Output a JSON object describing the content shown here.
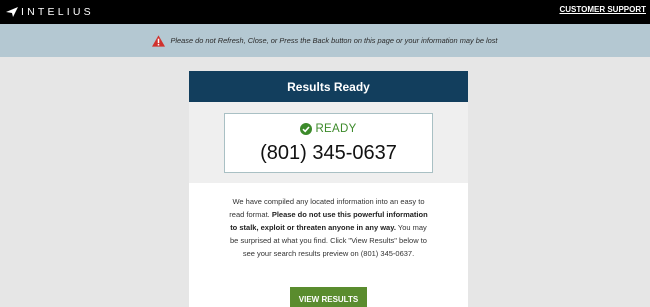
{
  "header": {
    "logo_text": "INTELIUS",
    "support_link": "CUSTOMER SUPPORT"
  },
  "warning": {
    "icon": "warning-triangle-icon",
    "text": "Please do not Refresh, Close, or Press the Back button on this page or your information may be lost"
  },
  "results": {
    "title": "Results Ready",
    "status_icon": "check-circle-icon",
    "status_label": "READY",
    "phone": "(801) 345-0637",
    "paragraph": {
      "part1": "We have compiled any located information into an easy to read format. ",
      "bold": "Please do not use this powerful information to stalk, exploit or threaten anyone in any way.",
      "part2": " You may be surprised at what you find. Click \"View Results\" below to see your search results preview on (801) 345-0637."
    },
    "button_label": "VIEW RESULTS"
  },
  "colors": {
    "header_bg": "#000000",
    "warning_bg": "#b4c8d2",
    "card_header_bg": "#123e5d",
    "ready_green": "#3c8a2a",
    "button_green": "#5a8c2e",
    "warning_red": "#d0312d"
  }
}
